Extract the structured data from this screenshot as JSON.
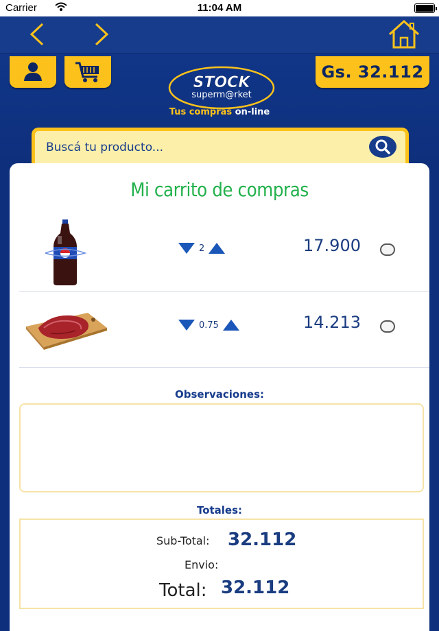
{
  "status_bar": {
    "carrier": "Carrier",
    "time": "11:04 AM"
  },
  "header": {
    "balance": "Gs. 32.112",
    "logo": {
      "brand_top": "STOCK",
      "brand_bottom": "superm@rket"
    },
    "slogan_main": "Tus compras",
    "slogan_online": "on-line",
    "search_placeholder": "Buscá tu producto..."
  },
  "cart": {
    "title": "Mi carrito de compras",
    "items": [
      {
        "product_icon": "soda-bottle-icon",
        "quantity": "2",
        "price": "17.900",
        "checked": false
      },
      {
        "product_icon": "meat-cut-icon",
        "quantity": "0.75",
        "price": "14.213",
        "checked": false
      }
    ],
    "observations_label": "Observaciones:",
    "observations_value": "",
    "totals_label": "Totales:",
    "subtotal_label": "Sub-Total:",
    "subtotal_value": "32.112",
    "shipping_label": "Envio:",
    "shipping_value": "",
    "total_label": "Total:",
    "total_value": "32.112"
  },
  "colors": {
    "nav_blue": "#173c8c",
    "accent_yellow": "#fcc21b",
    "title_green": "#22b14c",
    "price_blue": "#1a3c80"
  }
}
